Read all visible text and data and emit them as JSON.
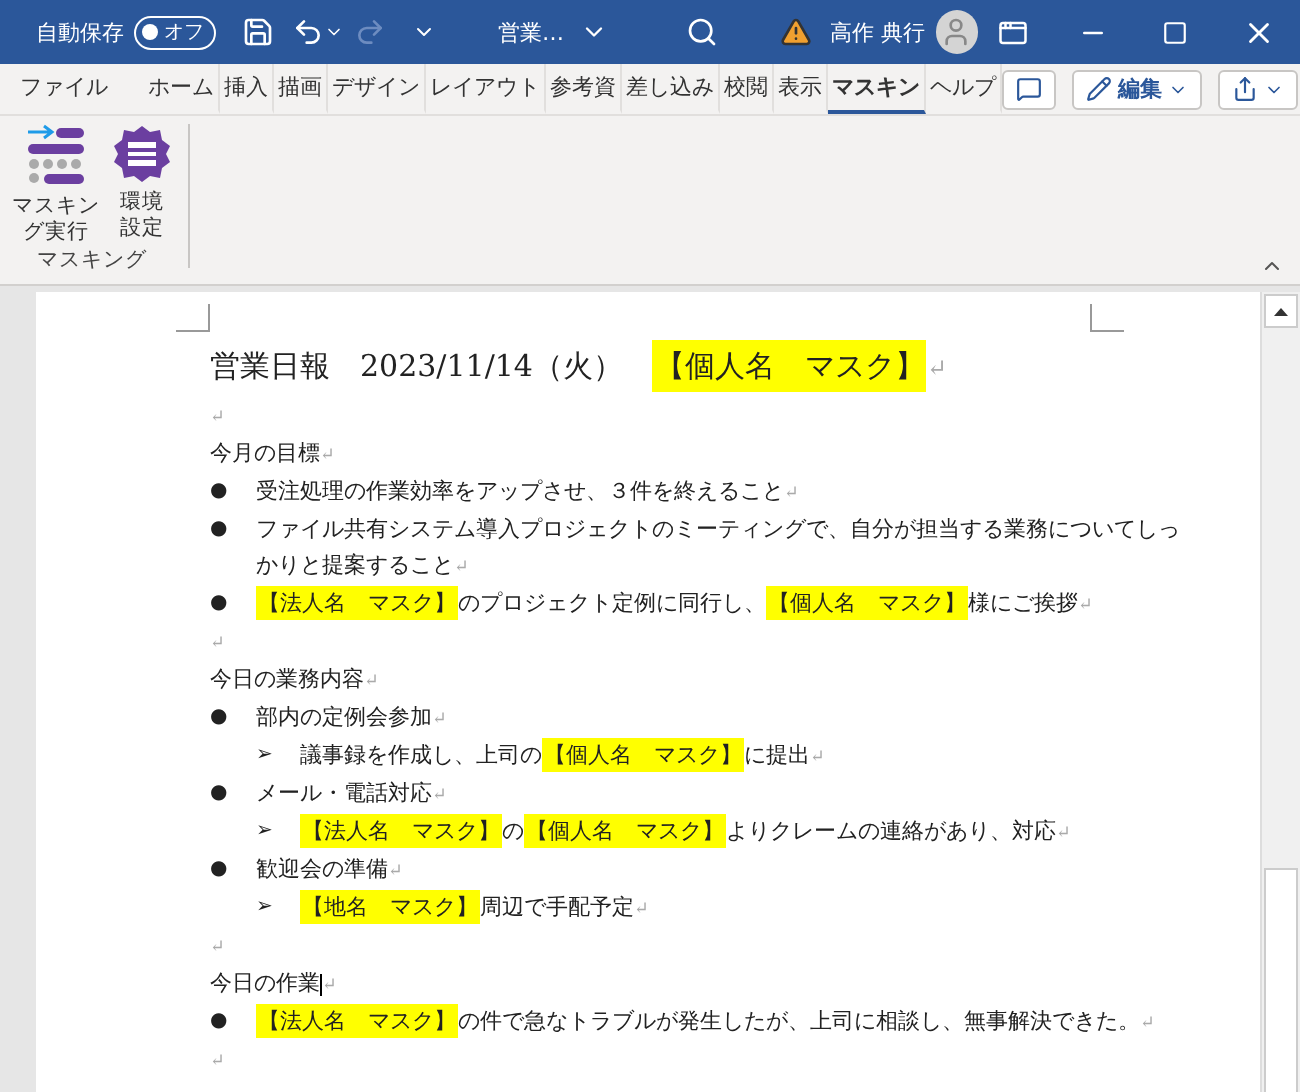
{
  "title_bar": {
    "autosave_label": "自動保存",
    "autosave_toggle": {
      "label": "オフ",
      "on": false
    },
    "redo_disabled": true,
    "document_title": "営業…",
    "user_name": "高作 典行"
  },
  "tabs": [
    {
      "label": "ファイル",
      "selected": false
    },
    {
      "label": "ホーム",
      "selected": false
    },
    {
      "label": "挿入",
      "selected": false
    },
    {
      "label": "描画",
      "selected": false
    },
    {
      "label": "デザイン",
      "selected": false
    },
    {
      "label": "レイアウト",
      "selected": false
    },
    {
      "label": "参考資",
      "selected": false
    },
    {
      "label": "差し込み",
      "selected": false
    },
    {
      "label": "校閲",
      "selected": false
    },
    {
      "label": "表示",
      "selected": false
    },
    {
      "label": "マスキン",
      "selected": true
    },
    {
      "label": "ヘルプ",
      "selected": false
    }
  ],
  "edit_button": "編集",
  "ribbon": {
    "buttons": [
      {
        "kind": "run",
        "label": "マスキング実行"
      },
      {
        "kind": "settings",
        "label": "環境設定"
      }
    ],
    "group_label": "マスキング"
  },
  "document": {
    "paragraphs": [
      {
        "kind": "heading",
        "caret": false,
        "segments": [
          {
            "kind": "text",
            "text": "営業日報　2023/11/14（火）　"
          },
          {
            "kind": "mask",
            "text": "【個人名　マスク】"
          },
          {
            "kind": "pilcrow",
            "text": "↵"
          }
        ]
      },
      {
        "kind": "empty",
        "caret": false,
        "segments": [
          {
            "kind": "pilcrow",
            "text": "↵"
          }
        ]
      },
      {
        "kind": "text",
        "caret": false,
        "segments": [
          {
            "kind": "text",
            "text": "今月の目標"
          },
          {
            "kind": "pilcrow",
            "text": "↵"
          }
        ]
      },
      {
        "kind": "bullet",
        "marker": "●",
        "caret": false,
        "segments": [
          {
            "kind": "text",
            "text": "受注処理の作業効率をアップさせ、３件を終えること"
          },
          {
            "kind": "pilcrow",
            "text": "↵"
          }
        ]
      },
      {
        "kind": "bullet",
        "marker": "●",
        "caret": false,
        "segments": [
          {
            "kind": "text",
            "text": "ファイル共有システム導入プロジェクトのミーティングで、自分が担当する業務についてしっかりと提案すること"
          },
          {
            "kind": "pilcrow",
            "text": "↵"
          }
        ]
      },
      {
        "kind": "bullet",
        "marker": "●",
        "caret": false,
        "segments": [
          {
            "kind": "mask",
            "text": "【法人名　マスク】"
          },
          {
            "kind": "text",
            "text": "のプロジェクト定例に同行し、"
          },
          {
            "kind": "mask",
            "text": "【個人名　マスク】"
          },
          {
            "kind": "text",
            "text": "様にご挨拶"
          },
          {
            "kind": "pilcrow",
            "text": "↵"
          }
        ]
      },
      {
        "kind": "empty",
        "caret": false,
        "segments": [
          {
            "kind": "pilcrow",
            "text": "↵"
          }
        ]
      },
      {
        "kind": "text",
        "caret": false,
        "segments": [
          {
            "kind": "text",
            "text": "今日の業務内容"
          },
          {
            "kind": "pilcrow",
            "text": "↵"
          }
        ]
      },
      {
        "kind": "bullet",
        "marker": "●",
        "caret": false,
        "segments": [
          {
            "kind": "text",
            "text": "部内の定例会参加"
          },
          {
            "kind": "pilcrow",
            "text": "↵"
          }
        ]
      },
      {
        "kind": "sub",
        "marker": "➢",
        "caret": false,
        "segments": [
          {
            "kind": "text",
            "text": "議事録を作成し、上司の"
          },
          {
            "kind": "mask",
            "text": "【個人名　マスク】"
          },
          {
            "kind": "text",
            "text": "に提出"
          },
          {
            "kind": "pilcrow",
            "text": "↵"
          }
        ]
      },
      {
        "kind": "bullet",
        "marker": "●",
        "caret": false,
        "segments": [
          {
            "kind": "text",
            "text": "メール・電話対応"
          },
          {
            "kind": "pilcrow",
            "text": "↵"
          }
        ]
      },
      {
        "kind": "sub",
        "marker": "➢",
        "caret": false,
        "segments": [
          {
            "kind": "mask",
            "text": "【法人名　マスク】"
          },
          {
            "kind": "text",
            "text": "の"
          },
          {
            "kind": "mask",
            "text": "【個人名　マスク】"
          },
          {
            "kind": "text",
            "text": "よりクレームの連絡があり、対応"
          },
          {
            "kind": "pilcrow",
            "text": "↵"
          }
        ]
      },
      {
        "kind": "bullet",
        "marker": "●",
        "caret": false,
        "segments": [
          {
            "kind": "text",
            "text": "歓迎会の準備"
          },
          {
            "kind": "pilcrow",
            "text": "↵"
          }
        ]
      },
      {
        "kind": "sub",
        "marker": "➢",
        "caret": false,
        "segments": [
          {
            "kind": "mask",
            "text": "【地名　マスク】"
          },
          {
            "kind": "text",
            "text": "周辺で手配予定"
          },
          {
            "kind": "pilcrow",
            "text": "↵"
          }
        ]
      },
      {
        "kind": "empty",
        "caret": false,
        "segments": [
          {
            "kind": "pilcrow",
            "text": "↵"
          }
        ]
      },
      {
        "kind": "text",
        "caret": true,
        "segments": [
          {
            "kind": "text",
            "text": "今日の作業"
          },
          {
            "kind": "pilcrow",
            "text": "↵"
          }
        ]
      },
      {
        "kind": "bullet",
        "marker": "●",
        "caret": false,
        "segments": [
          {
            "kind": "mask",
            "text": "【法人名　マスク】"
          },
          {
            "kind": "text",
            "text": "の件で急なトラブルが発生したが、上司に相談し、無事解決できた。"
          },
          {
            "kind": "pilcrow",
            "text": "↵"
          }
        ]
      },
      {
        "kind": "empty",
        "caret": false,
        "segments": [
          {
            "kind": "pilcrow",
            "text": "↵"
          }
        ]
      }
    ]
  }
}
